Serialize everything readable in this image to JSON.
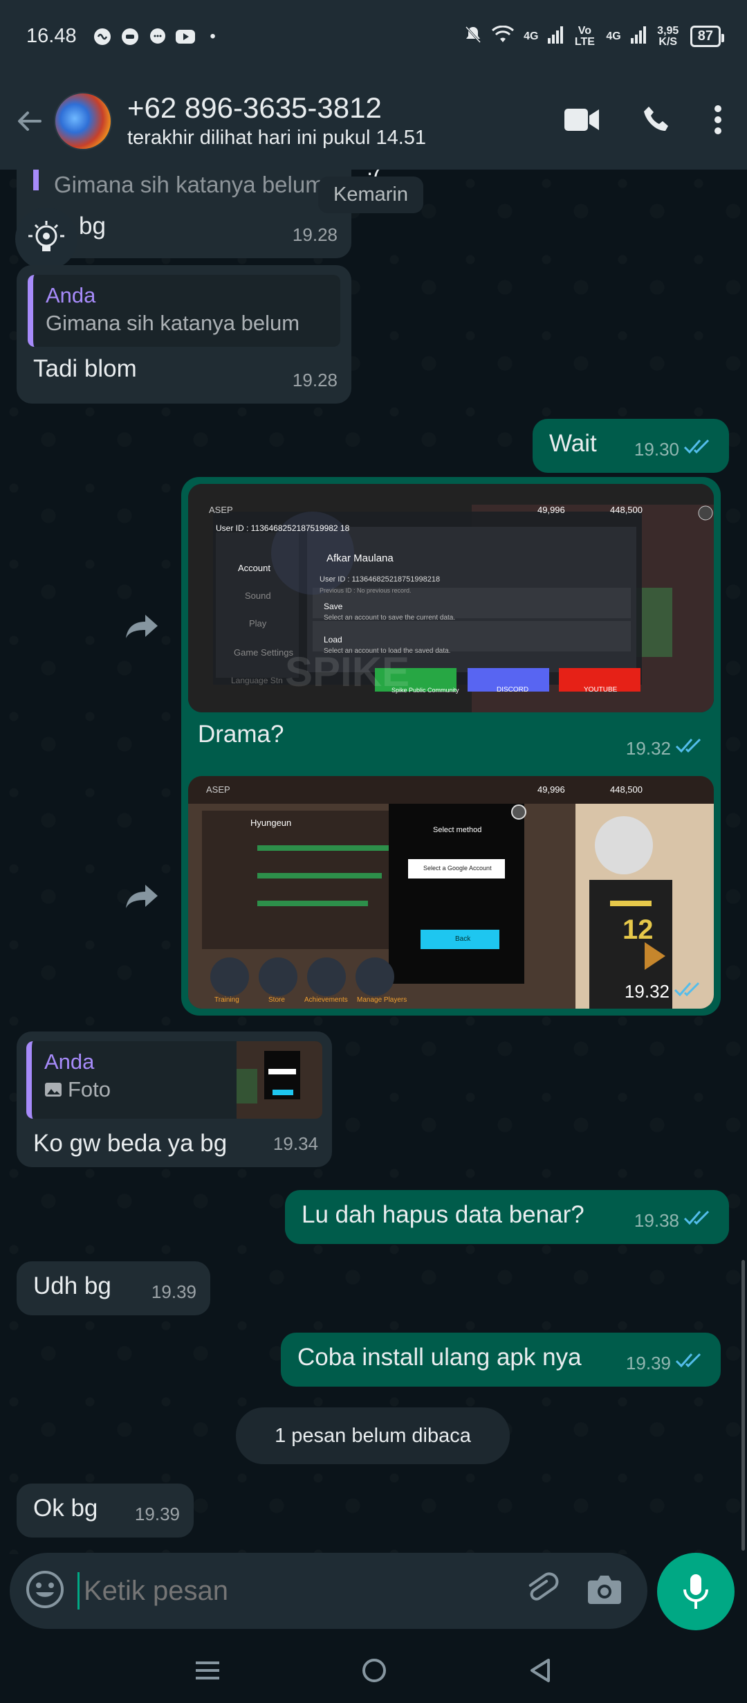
{
  "status_bar": {
    "time": "16.48",
    "network_4g_1": "4G",
    "volte": "Vo LTE",
    "network_4g_2": "4G",
    "speed": "3,95 K/S",
    "battery": "87"
  },
  "header": {
    "contact_name": "+62 896-3635-3812",
    "last_seen": "terakhir dilihat hari ini pukul 14.51"
  },
  "chat": {
    "day_chip": "Kemarin",
    "messages": [
      {
        "text": "bg",
        "time": "19.28",
        "quote_text": "Gimana sih katanya belum",
        "quote_suffix": ":("
      },
      {
        "quote_author": "Anda",
        "quote_text": "Gimana sih katanya belum",
        "text": "Tadi blom",
        "time": "19.28"
      },
      {
        "text": "Wait",
        "time": "19.30"
      },
      {
        "caption": "Drama?",
        "time": "19.32"
      },
      {
        "time": "19.32"
      },
      {
        "quote_author": "Anda",
        "quote_text": "Foto",
        "text": "Ko gw beda ya bg",
        "time": "19.34"
      },
      {
        "text": "Lu dah hapus data benar?",
        "time": "19.38"
      },
      {
        "text": "Udh bg",
        "time": "19.39"
      },
      {
        "text": "Coba install ulang apk nya",
        "time": "19.39"
      },
      {
        "text": "Ok bg",
        "time": "19.39"
      }
    ],
    "unread_chip": "1 pesan belum dibaca"
  },
  "screenshot1": {
    "user_label": "ASEP",
    "user_id": "User ID : 1136468252187519982 18",
    "currency1": "49,996",
    "currency2": "448,500",
    "tabs": [
      "Account",
      "Sound",
      "Play",
      "Game Settings",
      "Language Stn"
    ],
    "google_name": "Afkar Maulana",
    "user_id_inner": "User ID : 113646825218751998218",
    "previous_id": "Previous ID : No previous record.",
    "save_title": "Save",
    "save_desc": "Select an account to save the current data.",
    "load_title": "Load",
    "load_desc": "Select an account to load the saved data.",
    "btn_community": "Spike Public Community",
    "btn_discord": "DISCORD",
    "btn_youtube": "YOUTUBE",
    "watermark": "SPIKE"
  },
  "screenshot2": {
    "user_label": "ASEP",
    "currency1": "49,996",
    "currency2": "448,500",
    "player_name": "Hyungeun",
    "dialog_title": "Select method",
    "google_btn": "Select a Google Account",
    "back_btn": "Back",
    "menu": [
      "Training",
      "Store",
      "Achievements",
      "Manage Players"
    ],
    "jersey_number": "12"
  },
  "input": {
    "placeholder": "Ketik pesan"
  },
  "colors": {
    "incoming_bubble": "#202c33",
    "outgoing_bubble": "#005c4b",
    "accent": "#00a884",
    "tick_read": "#53bdeb",
    "quote_author": "#a78bfa"
  }
}
